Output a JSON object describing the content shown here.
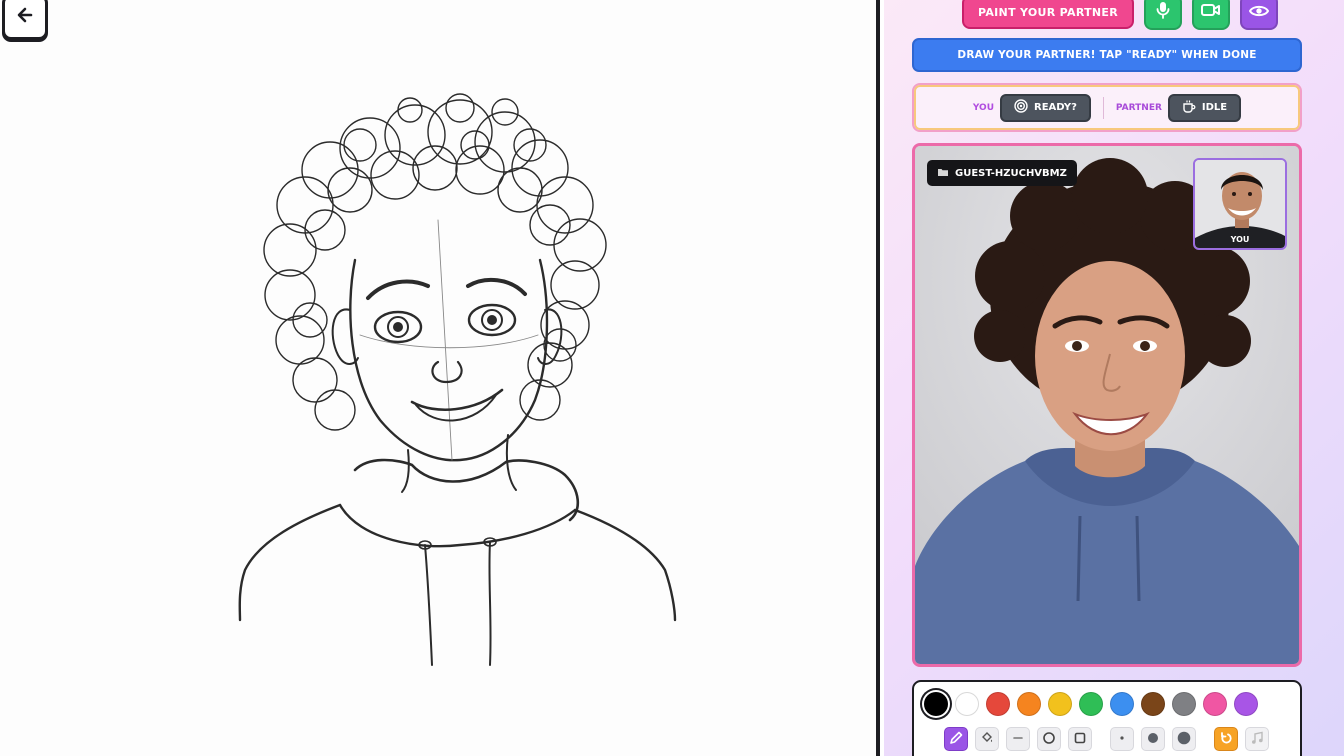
{
  "canvas": {
    "back_icon": "arrow-left-icon"
  },
  "header": {
    "paint_button_label": "PAINT YOUR PARTNER",
    "mic_icon": "microphone-icon",
    "camera_icon": "video-camera-icon",
    "watch_icon": "eye-icon",
    "colors": {
      "paint": "#f0478f",
      "mic": "#2cc56e",
      "camera": "#2cc56e",
      "watch": "#9a55e6"
    }
  },
  "banner": {
    "text": "DRAW YOUR PARTNER! TAP \"READY\" WHEN DONE",
    "color": "#3c7cf0"
  },
  "status": {
    "you_label": "YOU",
    "you_state": "READY?",
    "partner_label": "PARTNER",
    "partner_state": "IDLE"
  },
  "video": {
    "guest_name": "GUEST-HZUCHVBMZ",
    "self_label": "YOU"
  },
  "toolbox": {
    "colors": [
      "#000000",
      "#ffffff",
      "#e5483b",
      "#f5841f",
      "#f2c11d",
      "#2fbe56",
      "#3c8ff0",
      "#7a4519",
      "#7f8084",
      "#f056a3",
      "#a855e6"
    ],
    "selected_color": "#000000",
    "tools": [
      "pencil-icon",
      "fill-bucket-icon",
      "line-icon",
      "circle-icon",
      "square-icon",
      "small-brush-icon",
      "medium-brush-icon",
      "large-brush-icon",
      "undo-icon",
      "music-icon"
    ]
  }
}
